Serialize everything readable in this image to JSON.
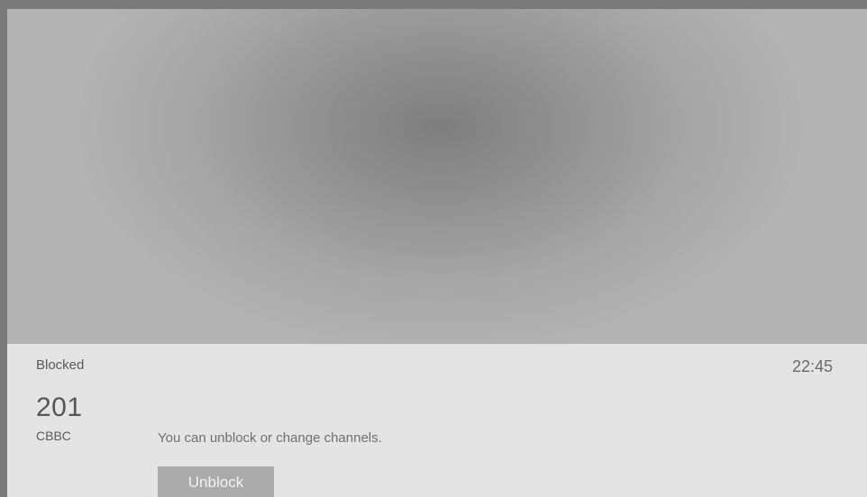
{
  "status": {
    "label": "Blocked",
    "time": "22:45"
  },
  "channel": {
    "number": "201",
    "name": "CBBC"
  },
  "message": "You can unblock or change channels.",
  "actions": {
    "unblock_label": "Unblock"
  },
  "colors": {
    "panel_background": "#e4e4e4",
    "video_center": "#7e7e7e",
    "video_edge": "#b3b3b3",
    "button_background": "#ababab"
  }
}
